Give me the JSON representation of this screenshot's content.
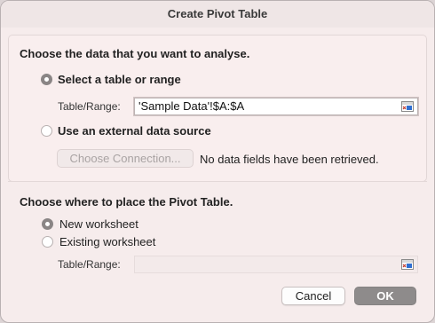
{
  "dialog": {
    "title": "Create Pivot Table"
  },
  "data_section": {
    "heading": "Choose the data that you want to analyse.",
    "select_range_label": "Select a table or range",
    "select_range_checked": true,
    "table_range_label": "Table/Range:",
    "table_range_value": "'Sample Data'!$A:$A",
    "external_source_label": "Use an external data source",
    "external_source_checked": false,
    "choose_connection_label": "Choose Connection...",
    "no_data_message": "No data fields have been retrieved."
  },
  "place_section": {
    "heading": "Choose where to place the Pivot Table.",
    "new_worksheet_label": "New worksheet",
    "new_worksheet_checked": true,
    "existing_worksheet_label": "Existing worksheet",
    "existing_worksheet_checked": false,
    "table_range_label": "Table/Range:",
    "table_range_value": ""
  },
  "buttons": {
    "cancel": "Cancel",
    "ok": "OK"
  },
  "icons": {
    "range_picker": "collapse-dialog-icon"
  },
  "colors": {
    "dialog_bg": "#f6ecec",
    "ok_button_bg": "#8e8b8b"
  }
}
